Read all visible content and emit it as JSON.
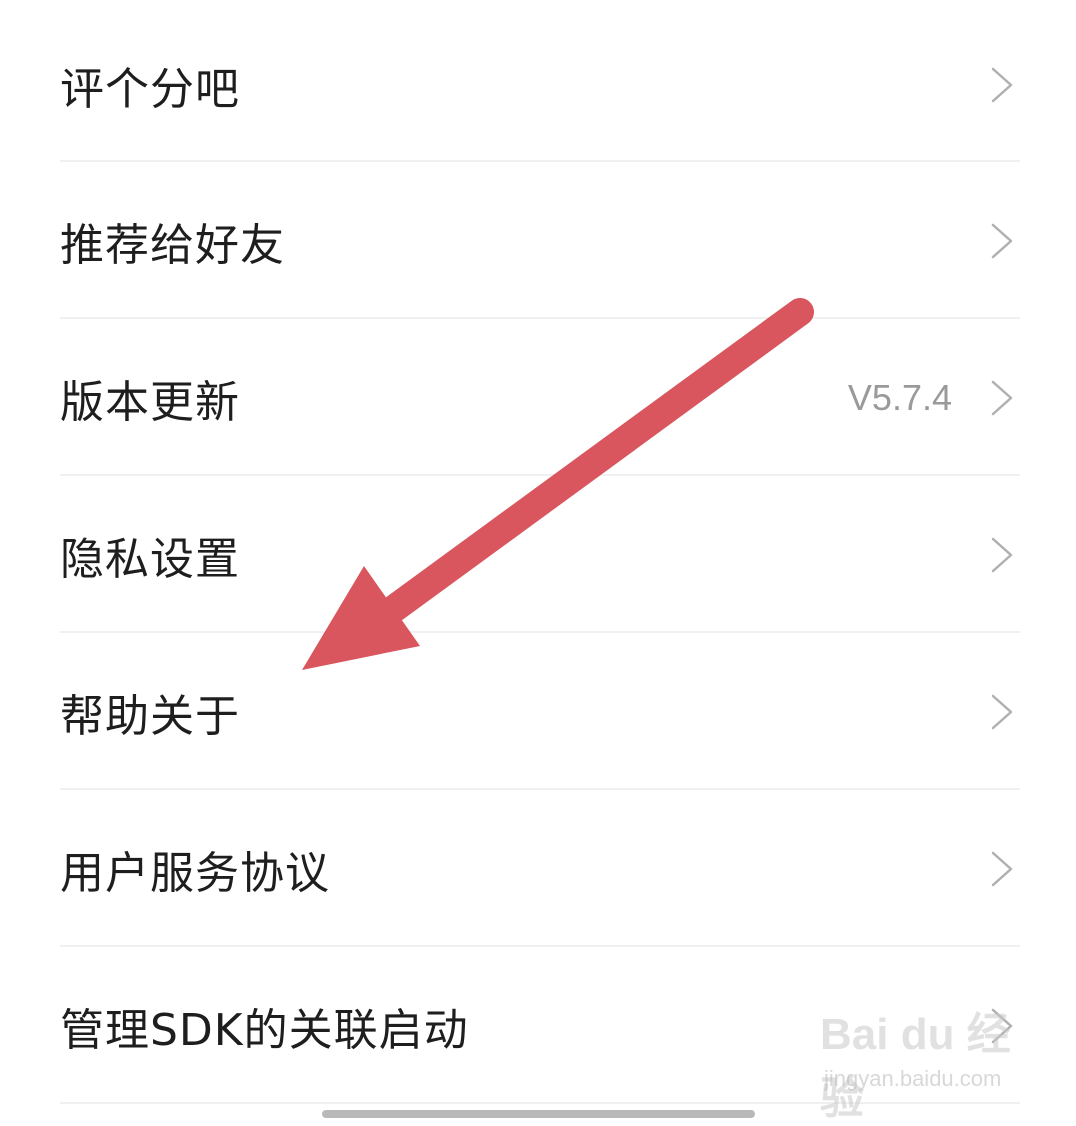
{
  "settings": {
    "items": [
      {
        "label": "评个分吧",
        "value": ""
      },
      {
        "label": "推荐给好友",
        "value": ""
      },
      {
        "label": "版本更新",
        "value": "V5.7.4"
      },
      {
        "label": "隐私设置",
        "value": ""
      },
      {
        "label": "帮助关于",
        "value": ""
      },
      {
        "label": "用户服务协议",
        "value": ""
      },
      {
        "label": "管理SDK的关联启动",
        "value": ""
      }
    ]
  },
  "annotation": {
    "arrow_color": "#d9565e",
    "icon": "arrow-icon"
  },
  "watermark": {
    "logo_text": "Bai du 经验",
    "url_text": "jingyan.baidu.com"
  },
  "colors": {
    "text": "#1e1e1e",
    "secondary_text": "#9a9a9a",
    "divider": "#f0f0f0",
    "chevron": "#b0b0b0"
  }
}
